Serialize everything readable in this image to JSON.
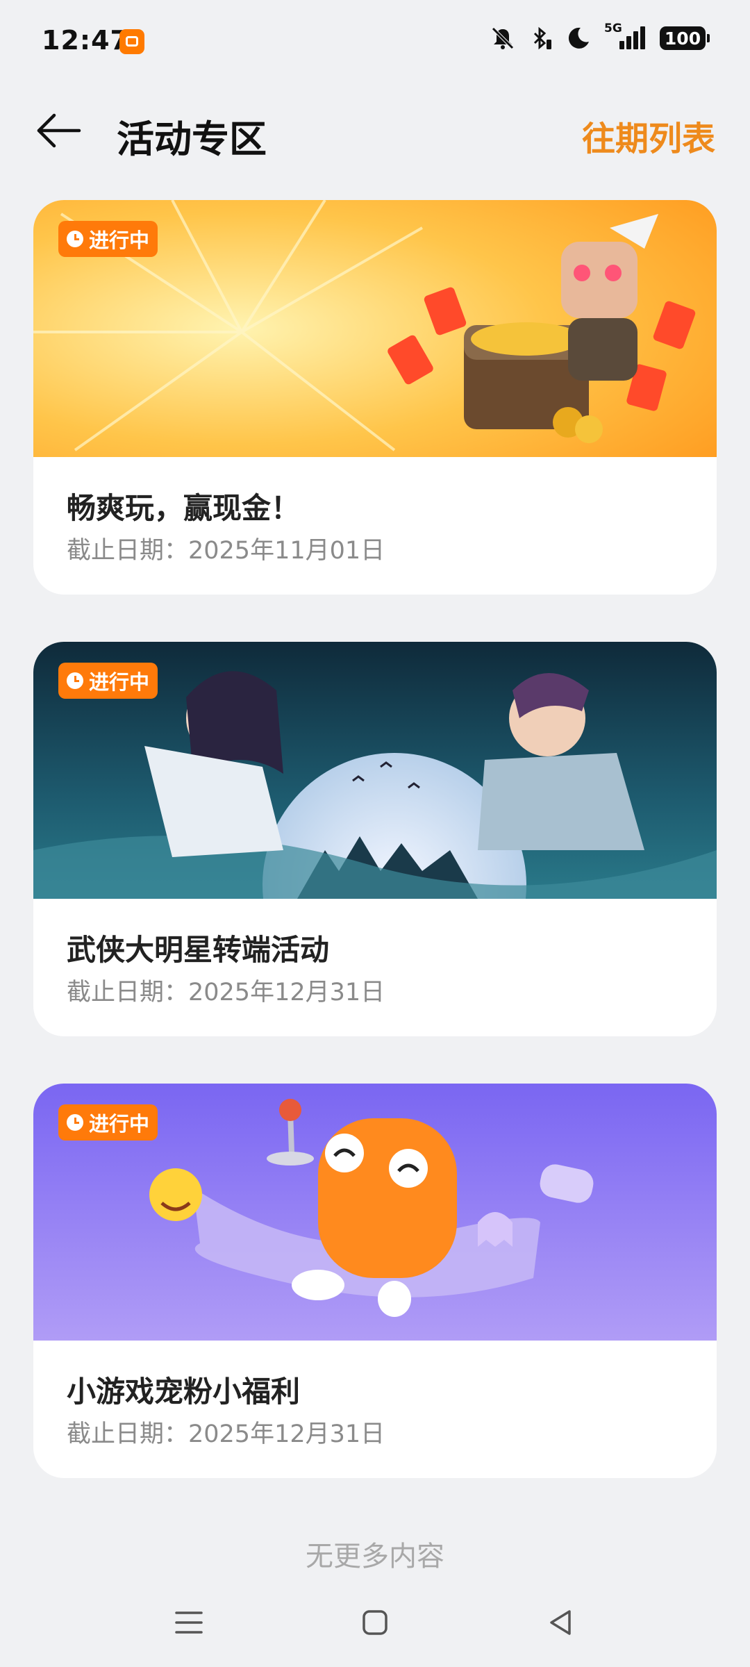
{
  "status_bar": {
    "time": "12:47",
    "network": "5G",
    "battery": "100",
    "icons": [
      "app-notification-icon",
      "mute-icon",
      "bluetooth-icon",
      "do-not-disturb-moon-icon",
      "signal-icon",
      "battery-icon"
    ]
  },
  "header": {
    "title": "活动专区",
    "history_link": "往期列表",
    "accent_color": "#ee8a1c"
  },
  "events": [
    {
      "status": "进行中",
      "title": "畅爽玩，赢现金！",
      "deadline": "截止日期：2025年11月01日",
      "banner_theme": "orange"
    },
    {
      "status": "进行中",
      "title": "武侠大明星转端活动",
      "deadline": "截止日期：2025年12月31日",
      "banner_theme": "teal-night"
    },
    {
      "status": "进行中",
      "title": "小游戏宠粉小福利",
      "deadline": "截止日期：2025年12月31日",
      "banner_theme": "purple"
    }
  ],
  "footer": {
    "note": "无更多内容"
  },
  "nav": {
    "buttons": [
      "menu-icon",
      "home-icon",
      "back-triangle-icon"
    ]
  }
}
